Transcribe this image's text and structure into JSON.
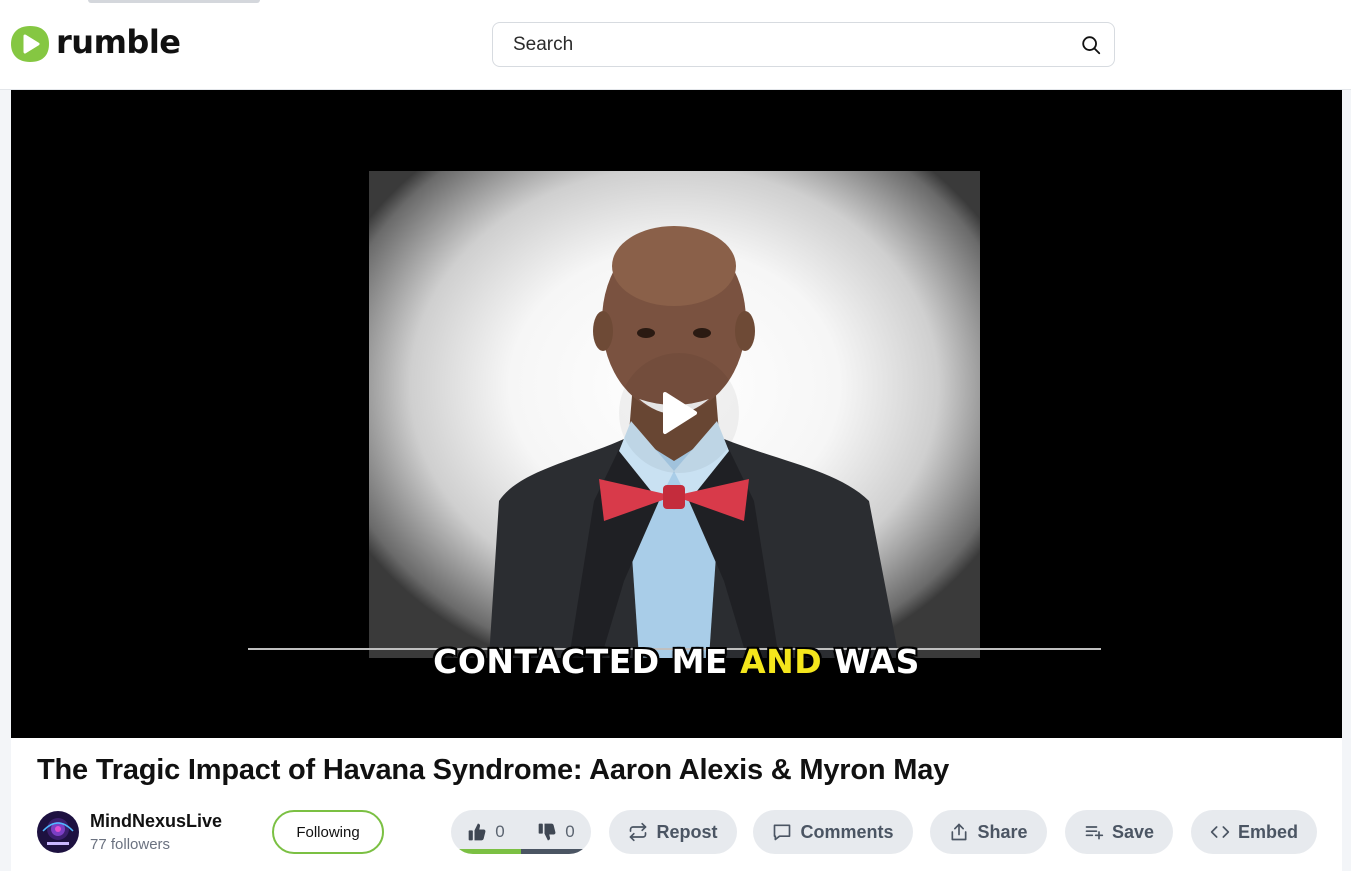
{
  "header": {
    "brand": "rumble",
    "search": {
      "placeholder": "Search",
      "value": ""
    }
  },
  "player": {
    "caption_before": "CONTACTED ME ",
    "caption_highlight": "AND",
    "caption_after": " WAS"
  },
  "video": {
    "title": "The Tragic Impact of Havana Syndrome: Aaron Alexis & Myron May"
  },
  "channel": {
    "name": "MindNexusLive",
    "followers": "77 followers",
    "follow_label": "Following"
  },
  "actions": {
    "likes": "0",
    "dislikes": "0",
    "repost": "Repost",
    "comments": "Comments",
    "share": "Share",
    "save": "Save",
    "embed": "Embed"
  },
  "colors": {
    "brand_green": "#85c742",
    "follow_border": "#7bc043",
    "like_bar": "#7bc043",
    "dislike_bar": "#4b5563",
    "caption_highlight": "#f4e61c"
  },
  "icons": [
    "rumble-logo-icon",
    "search-icon",
    "play-icon",
    "thumbs-up-icon",
    "thumbs-down-icon",
    "repost-icon",
    "comment-icon",
    "share-icon",
    "save-icon",
    "embed-icon"
  ]
}
